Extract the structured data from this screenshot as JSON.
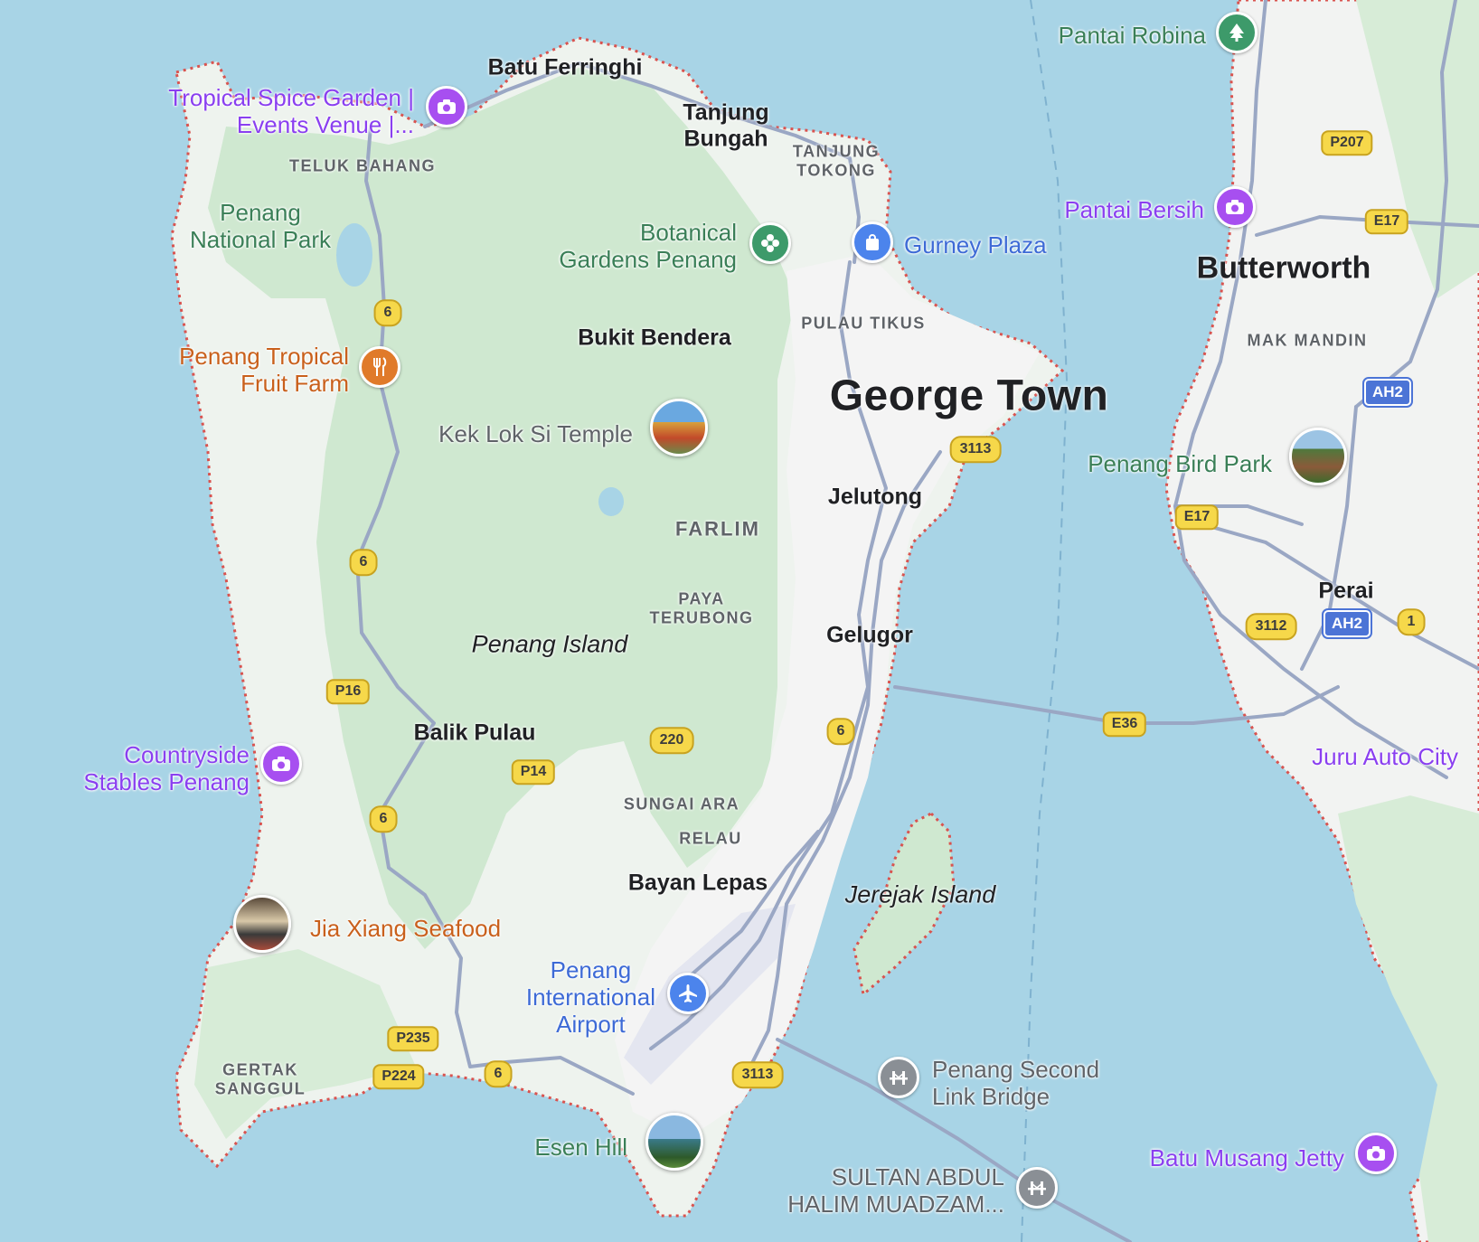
{
  "map": {
    "colors": {
      "water": "#a8d4e6",
      "land": "#eef3ee",
      "forest": "#cfe8d0",
      "urban": "#f4f4f4",
      "road": "#9aa7c4",
      "border": "#d9534f"
    },
    "labels": {
      "batu_ferringhi": "Batu Ferringhi",
      "tanjung_bungah": "Tanjung\nBungah",
      "tanjung_tokong": "TANJUNG\nTOKONG",
      "teluk_bahang": "TELUK BAHANG",
      "penang_national_park": "Penang\nNational Park",
      "bukit_bendera": "Bukit Bendera",
      "pulau_tikus": "PULAU TIKUS",
      "george_town": "George Town",
      "butterworth": "Butterworth",
      "mak_mandin": "MAK MANDIN",
      "jelutong": "Jelutong",
      "farlim": "FARLIM",
      "paya_terubong": "PAYA\nTERUBONG",
      "penang_island": "Penang Island",
      "gelugor": "Gelugor",
      "perai": "Perai",
      "balik_pulau": "Balik Pulau",
      "sungai_ara": "SUNGAI ARA",
      "relau": "RELAU",
      "bayan_lepas": "Bayan Lepas",
      "jerejak_island": "Jerejak Island",
      "gertak_sanggul": "GERTAK\nSANGGUL"
    },
    "pois": {
      "tropical_spice": {
        "label": "Tropical Spice Garden |\nEvents Venue |...",
        "icon": "camera-icon"
      },
      "pantai_robina": {
        "label": "Pantai Robina",
        "icon": "tree-icon"
      },
      "pantai_bersih": {
        "label": "Pantai Bersih",
        "icon": "camera-icon"
      },
      "botanical_gardens": {
        "label": "Botanical\nGardens Penang",
        "icon": "flower-icon"
      },
      "gurney_plaza": {
        "label": "Gurney Plaza",
        "icon": "shopping-bag-icon"
      },
      "fruit_farm": {
        "label": "Penang Tropical\nFruit Farm",
        "icon": "restaurant-icon"
      },
      "kek_lok_si": {
        "label": "Kek Lok Si Temple",
        "icon": "photo-thumbnail"
      },
      "bird_park": {
        "label": "Penang Bird Park",
        "icon": "photo-thumbnail"
      },
      "countryside_stables": {
        "label": "Countryside\nStables Penang",
        "icon": "camera-icon"
      },
      "juru_auto_city": {
        "label": "Juru Auto City",
        "icon": ""
      },
      "jia_xiang": {
        "label": "Jia Xiang Seafood",
        "icon": "photo-thumbnail"
      },
      "airport": {
        "label": "Penang\nInternational\nAirport",
        "icon": "airplane-icon"
      },
      "second_link": {
        "label": "Penang Second\nLink Bridge",
        "icon": "bridge-icon"
      },
      "esen_hill": {
        "label": "Esen Hill",
        "icon": "photo-thumbnail"
      },
      "sultan_abdul": {
        "label": "SULTAN ABDUL\nHALIM MUADZAM...",
        "icon": "bridge-icon"
      },
      "batu_musang": {
        "label": "Batu Musang Jetty",
        "icon": "camera-icon"
      }
    },
    "shields": {
      "r6_a": "6",
      "r6_b": "6",
      "r6_c": "6",
      "r6_d": "6",
      "r6_e": "6",
      "p207": "P207",
      "e17_a": "E17",
      "e17_b": "E17",
      "ah2_a": "AH2",
      "ah2_b": "AH2",
      "r3113_a": "3113",
      "r3113_b": "3113",
      "r3112": "3112",
      "r1": "1",
      "p16": "P16",
      "r220": "220",
      "p14": "P14",
      "e36": "E36",
      "p235": "P235",
      "p224": "P224"
    }
  }
}
